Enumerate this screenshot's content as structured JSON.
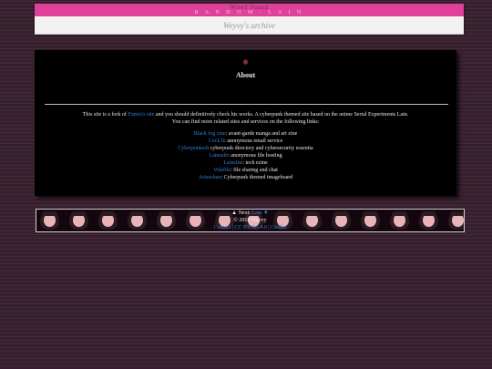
{
  "header": {
    "site_name": "Wired Sound",
    "subtitle": "R A N D O M · L A I N",
    "archive_title": "Weyvy's archive"
  },
  "about": {
    "emblem_icon": "emblem-icon",
    "heading": "About",
    "intro": {
      "text_before": "This site is a fork of ",
      "link_text": "Fumix's site",
      "text_after": " and you should definitively check his works. A cyberpunk themed site based on the anime Serial Experiments Lain.",
      "line2": "You can find more related sites and services on the following links:"
    },
    "links": [
      {
        "name": "Black fog zine",
        "desc": ": avant-garde manga and art zine"
      },
      {
        "name": "Cock.li",
        "desc": ": anonymous email service"
      },
      {
        "name": "Cyberpunked",
        "desc": ": cyberpunk directory and cybersecurity essentia"
      },
      {
        "name": "Lainsafe",
        "desc": ": anonymous file hosting"
      },
      {
        "name": "Lainzine",
        "desc": ": tech ezine"
      },
      {
        "name": "Volafile",
        "desc": ": file sharing and chat"
      },
      {
        "name": "Arisuchan",
        "desc": ": Cyberpunk themed imageboard"
      }
    ]
  },
  "footer": {
    "nav": {
      "up_arrow": "▲",
      "next_label": "Next",
      "link_text": "Lain",
      "down_arrow": "▼"
    },
    "copyright": "© 2018 Weyvy",
    "contact_text": "Contact | CC BY-SA 4.0 | Credits"
  },
  "colors": {
    "accent_pink": "#e0409a",
    "link_blue": "#2f80d8",
    "panel_black": "#000000"
  }
}
